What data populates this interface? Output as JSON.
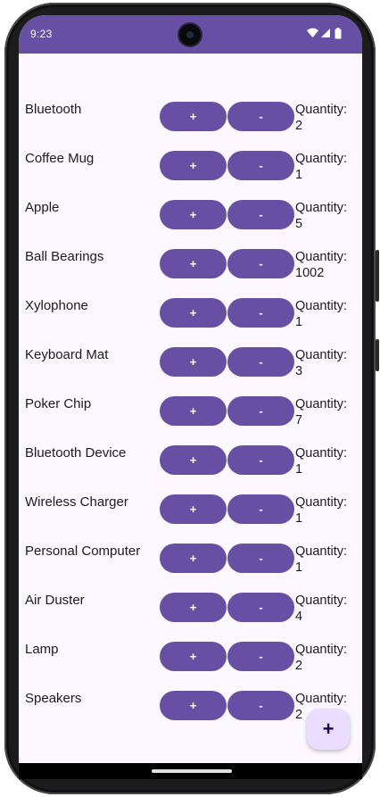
{
  "status_bar": {
    "time": "9:23",
    "icons": [
      "wifi-icon",
      "signal-icon",
      "battery-icon"
    ]
  },
  "colors": {
    "primary": "#6750a4",
    "background": "#fdf7ff",
    "fab_background": "#eaddff",
    "fab_icon": "#21005d"
  },
  "buttons": {
    "plus_label": "+",
    "minus_label": "-"
  },
  "quantity_label": "Quantity:",
  "items": [
    {
      "name": "Bluetooth",
      "quantity": "2"
    },
    {
      "name": "Coffee Mug",
      "quantity": "1"
    },
    {
      "name": "Apple",
      "quantity": "5"
    },
    {
      "name": "Ball Bearings",
      "quantity": "1002"
    },
    {
      "name": "Xylophone",
      "quantity": "1"
    },
    {
      "name": "Keyboard Mat",
      "quantity": "3"
    },
    {
      "name": "Poker Chip",
      "quantity": "7"
    },
    {
      "name": "Bluetooth Device",
      "quantity": "1"
    },
    {
      "name": "Wireless Charger",
      "quantity": "1"
    },
    {
      "name": "Personal Computer",
      "quantity": "1"
    },
    {
      "name": "Air Duster",
      "quantity": "4"
    },
    {
      "name": "Lamp",
      "quantity": "2"
    },
    {
      "name": "Speakers",
      "quantity": "2"
    }
  ],
  "fab": {
    "label": "+",
    "icon": "add-icon"
  }
}
